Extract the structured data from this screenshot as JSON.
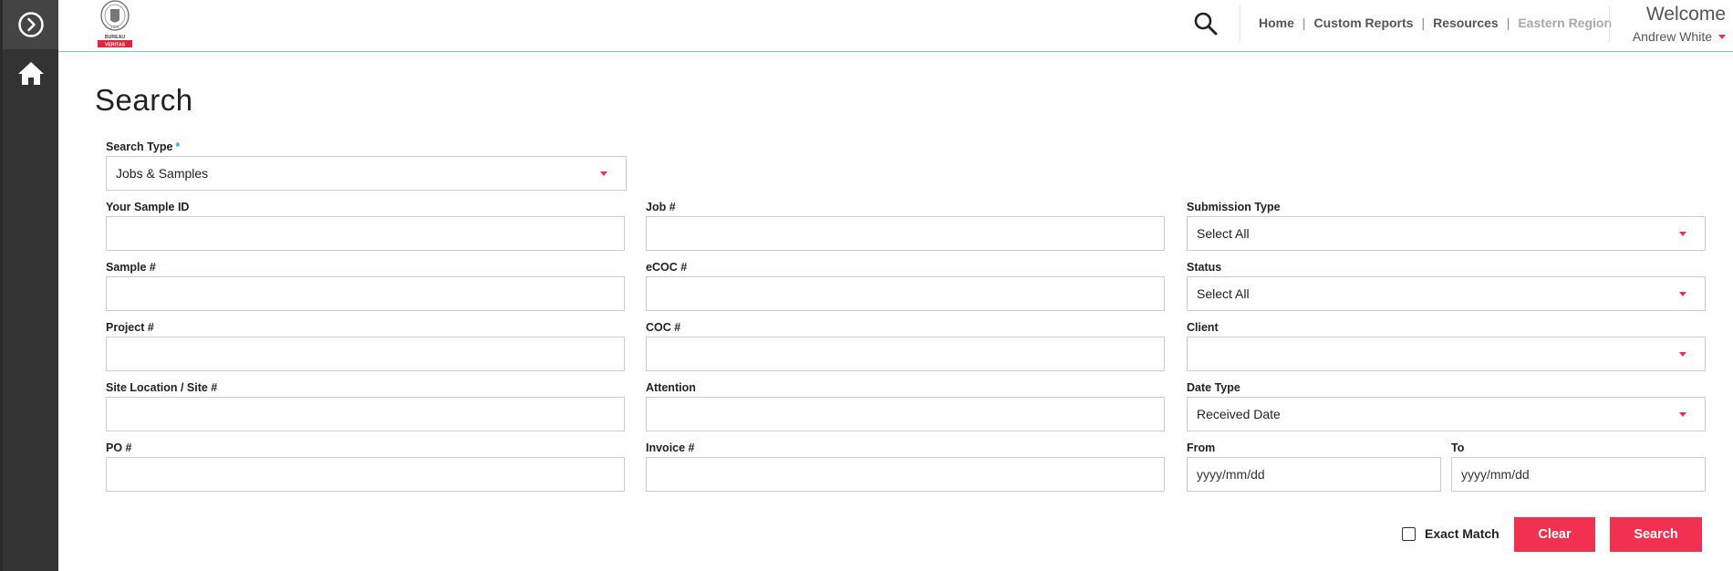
{
  "header": {
    "nav": [
      {
        "label": "Home",
        "muted": false
      },
      {
        "label": "Custom Reports",
        "muted": false
      },
      {
        "label": "Resources",
        "muted": false
      },
      {
        "label": "Eastern Region",
        "muted": true
      }
    ],
    "welcome": "Welcome",
    "user_name": "Andrew White"
  },
  "page": {
    "title": "Search"
  },
  "form": {
    "search_type": {
      "label": "Search Type",
      "required_mark": "*",
      "value": "Jobs & Samples"
    },
    "your_sample_id": {
      "label": "Your Sample ID",
      "value": ""
    },
    "job_no": {
      "label": "Job #",
      "value": ""
    },
    "submission_type": {
      "label": "Submission Type",
      "value": "Select All"
    },
    "sample_no": {
      "label": "Sample #",
      "value": ""
    },
    "ecoc_no": {
      "label": "eCOC #",
      "value": ""
    },
    "status": {
      "label": "Status",
      "value": "Select All"
    },
    "project_no": {
      "label": "Project #",
      "value": ""
    },
    "coc_no": {
      "label": "COC #",
      "value": ""
    },
    "client": {
      "label": "Client",
      "value": ""
    },
    "site_location": {
      "label": "Site Location / Site #",
      "value": ""
    },
    "attention": {
      "label": "Attention",
      "value": ""
    },
    "date_type": {
      "label": "Date Type",
      "value": "Received Date"
    },
    "po_no": {
      "label": "PO #",
      "value": ""
    },
    "invoice_no": {
      "label": "Invoice #",
      "value": ""
    },
    "from": {
      "label": "From",
      "placeholder": "yyyy/mm/dd"
    },
    "to": {
      "label": "To",
      "placeholder": "yyyy/mm/dd"
    }
  },
  "actions": {
    "exact_match_label": "Exact Match",
    "exact_match_checked": false,
    "clear_label": "Clear",
    "search_label": "Search"
  },
  "colors": {
    "accent": "#f2304f",
    "sidebar": "#333333",
    "required": "#1e9fd8"
  },
  "icons": [
    "chevron-right-circle-icon",
    "home-icon",
    "bureau-veritas-logo",
    "search-icon",
    "caret-down-icon"
  ],
  "logo": {
    "top_text": "BUREAU",
    "bottom_text": "VERITAS",
    "seal_text": "1828"
  }
}
